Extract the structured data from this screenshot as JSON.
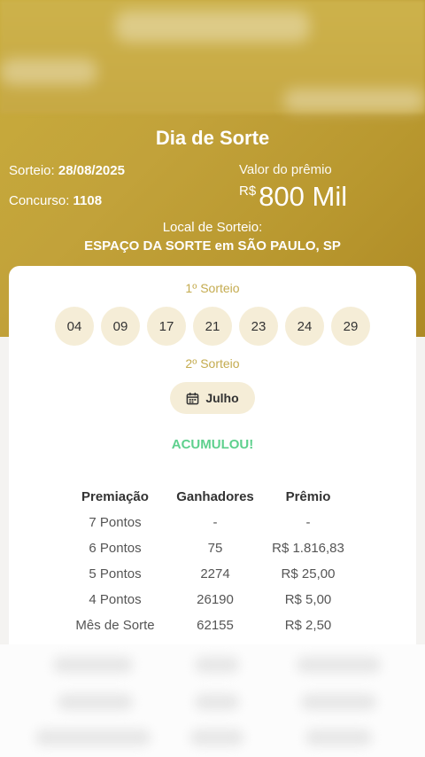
{
  "header": {
    "title": "Dia de Sorte",
    "sorteio_label": "Sorteio:",
    "sorteio_date": "28/08/2025",
    "concurso_label": "Concurso:",
    "concurso_number": "1108",
    "prize_label": "Valor do prêmio",
    "prize_currency": "R$",
    "prize_amount": "800 Mil",
    "local_label": "Local de Sorteio:",
    "local_value": "ESPAÇO DA SORTE em SÃO PAULO, SP"
  },
  "card": {
    "first_draw_label": "1º Sorteio",
    "numbers": [
      "04",
      "09",
      "17",
      "21",
      "23",
      "24",
      "29"
    ],
    "second_draw_label": "2º Sorteio",
    "month": "Julho",
    "status": "ACUMULOU!",
    "table": {
      "headers": [
        "Premiação",
        "Ganhadores",
        "Prêmio"
      ],
      "rows": [
        [
          "7 Pontos",
          "-",
          "-"
        ],
        [
          "6 Pontos",
          "75",
          "R$ 1.816,83"
        ],
        [
          "5 Pontos",
          "2274",
          "R$ 25,00"
        ],
        [
          "4 Pontos",
          "26190",
          "R$ 5,00"
        ],
        [
          "Mês de Sorte",
          "62155",
          "R$ 2,50"
        ]
      ]
    }
  },
  "colors": {
    "gold": "#c2a23a",
    "accent_text": "#c4ab4f",
    "ball_bg": "#f5edd7",
    "success": "#5ed08d"
  },
  "icons": {
    "month": "calendar-icon"
  }
}
